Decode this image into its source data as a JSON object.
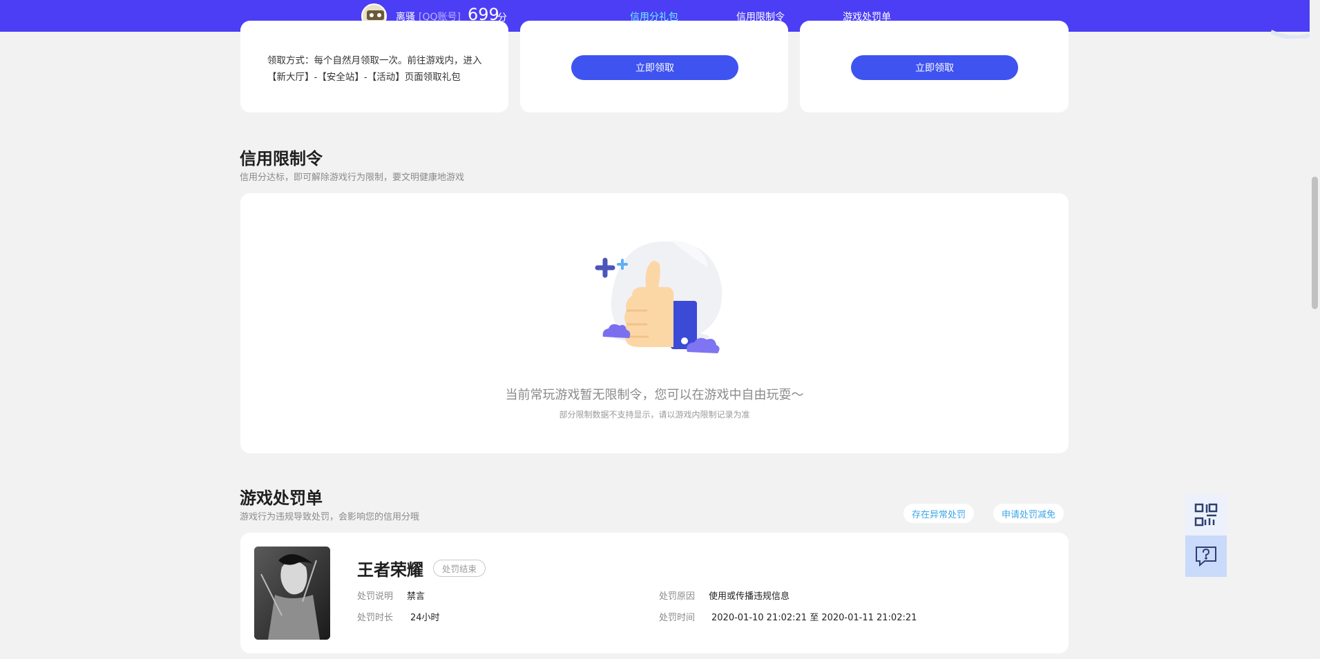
{
  "header": {
    "user_name": "离骚",
    "account_type": "[QQ账号]",
    "score": "699",
    "score_unit": "分",
    "tabs": [
      {
        "label": "信用分礼包",
        "active": true
      },
      {
        "label": "信用限制令",
        "active": false
      },
      {
        "label": "游戏处罚单",
        "active": false
      }
    ]
  },
  "gift": {
    "desc": "领取方式：每个自然月领取一次。前往游戏内，进入【新大厅】-【安全站】-【活动】页面领取礼包",
    "claim_label": "立即领取"
  },
  "restriction": {
    "title": "信用限制令",
    "subtitle": "信用分达标，即可解除游戏行为限制，要文明健康地游戏",
    "empty_main": "当前常玩游戏暂无限制令，您可以在游戏中自由玩耍～",
    "empty_sub": "部分限制数据不支持显示，请以游戏内限制记录为准"
  },
  "penalty": {
    "title": "游戏处罚单",
    "subtitle": "游戏行为违规导致处罚，会影响您的信用分哦",
    "btn_abnormal": "存在异常处罚",
    "btn_reduce": "申请处罚减免",
    "item": {
      "game": "王者荣耀",
      "status": "处罚结束",
      "desc_label": "处罚说明",
      "desc_value": "禁言",
      "reason_label": "处罚原因",
      "reason_value": "使用或传播违规信息",
      "duration_label": "处罚时长",
      "duration_value": "24小时",
      "time_label": "处罚时间",
      "time_value": "2020-01-10 21:02:21 至 2020-01-11 21:02:21"
    }
  },
  "colors": {
    "brand": "#4c3ef5",
    "button": "#3e53f0",
    "active_tab": "#6ff0ff"
  },
  "icons": [
    "qr-code-icon",
    "help-chat-icon",
    "thumbs-up-illustration"
  ]
}
